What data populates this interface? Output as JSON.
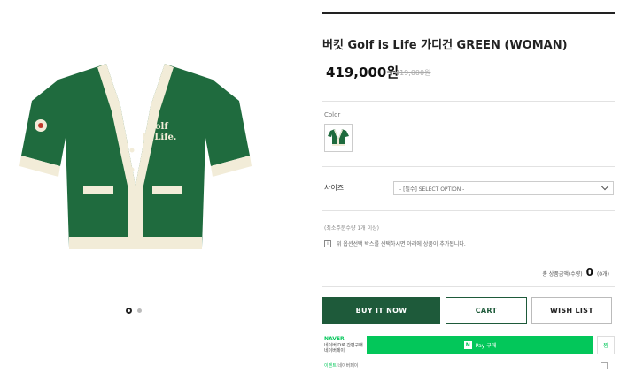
{
  "product": {
    "title": "버킷 Golf is Life 가디건 GREEN (WOMAN)",
    "price": "419,000원",
    "original_price": "419,000원",
    "image_text_line1": "Golf",
    "image_text_line2": "Is Life.",
    "main_color": "#1f6b3e",
    "trim_color": "#f2ecd8"
  },
  "gallery": {
    "total_slides": 2,
    "active_slide": 1
  },
  "color": {
    "label": "Color"
  },
  "size": {
    "label": "사이즈",
    "placeholder": "- [필수] SELECT OPTION -"
  },
  "min_qty": "(최소주문수량 1개 이상)",
  "notice": {
    "icon": "i",
    "text": "위 옵션선택 박스를 선택하시면 아래에 상품이 추가됩니다."
  },
  "total": {
    "label": "총 상품금액(수량)",
    "amount": "0",
    "unit": "(0개)"
  },
  "buttons": {
    "buy": "BUY IT NOW",
    "cart": "CART",
    "wish": "WISH LIST"
  },
  "naver": {
    "brand": "NAVER",
    "desc": "네이버ID로 간편구매 네이버페이",
    "pay_label": "Pay 구매",
    "pay_badge": "N",
    "fav_label": "찜",
    "footer_prefix": "이벤트",
    "footer_text": "네이버페이",
    "accent": "#03c75a"
  },
  "brand_color": "#1e5a3a"
}
